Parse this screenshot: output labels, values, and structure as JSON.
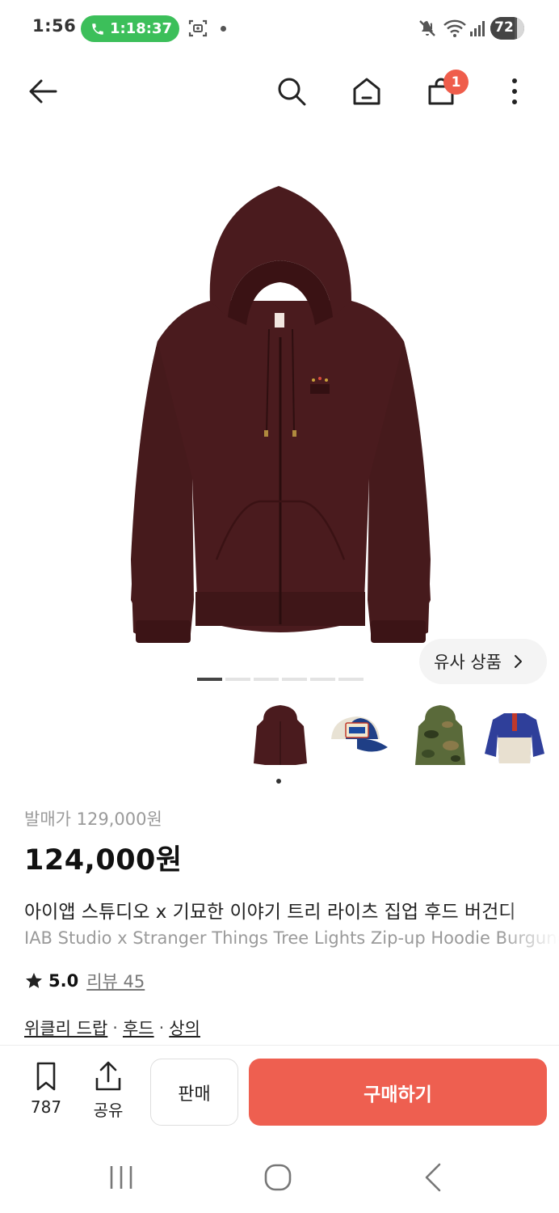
{
  "status_bar": {
    "time": "1:56",
    "call_timer": "1:18:37",
    "battery": "72",
    "battery_level": 0.72
  },
  "nav": {
    "cart_count": "1"
  },
  "hero": {
    "similar_label": "유사 상품",
    "pager_count": 6,
    "pager_active": 0
  },
  "thumbnails": [
    {
      "name": "hoodie",
      "color": "#4a1b1e"
    },
    {
      "name": "trucker-cap",
      "color": "#1f3f86"
    },
    {
      "name": "camo-hoodie",
      "color": "#5a6a3a"
    },
    {
      "name": "fleece-pullover",
      "color": "#2f3f9a"
    }
  ],
  "product": {
    "original_price": "발매가 129,000원",
    "price": "124,000원",
    "name_ko": "아이앱 스튜디오 x 기묘한 이야기 트리 라이츠 집업 후드 버건디",
    "name_en": "IAB Studio x Stranger Things Tree Lights Zip-up Hoodie Burgundy",
    "rating": "5.0",
    "review_link": "리뷰 45",
    "categories": [
      "위클리 드랍",
      "후드",
      "상의"
    ],
    "category_separator": "·"
  },
  "bottom_bar": {
    "bookmark_count": "787",
    "share_label": "공유",
    "sell_label": "판매",
    "buy_label": "구매하기"
  },
  "colors": {
    "accent": "#ee5f50",
    "call_green": "#3cbf5a",
    "hoodie": "#4a1b1e"
  }
}
